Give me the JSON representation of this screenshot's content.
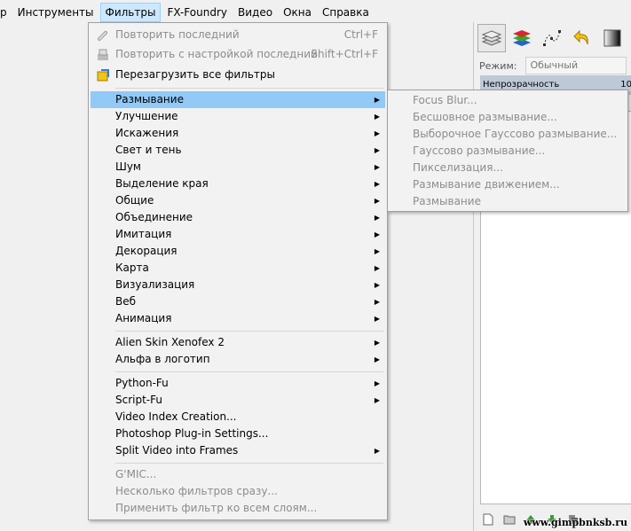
{
  "menubar": {
    "items": [
      {
        "label": "р"
      },
      {
        "label": "Инструменты"
      },
      {
        "label": "Фильтры"
      },
      {
        "label": "FX-Foundry"
      },
      {
        "label": "Видео"
      },
      {
        "label": "Окна"
      },
      {
        "label": "Справка"
      }
    ]
  },
  "filters_menu": {
    "repeat_last": {
      "label": "Повторить последний",
      "shortcut": "Ctrl+F"
    },
    "reshow_last": {
      "label": "Повторить с настройкой последний",
      "shortcut": "Shift+Ctrl+F"
    },
    "reset_all": {
      "label": "Перезагрузить все фильтры"
    },
    "categories": [
      {
        "label": "Размывание"
      },
      {
        "label": "Улучшение"
      },
      {
        "label": "Искажения"
      },
      {
        "label": "Свет и тень"
      },
      {
        "label": "Шум"
      },
      {
        "label": "Выделение края"
      },
      {
        "label": "Общие"
      },
      {
        "label": "Объединение"
      },
      {
        "label": "Имитация"
      },
      {
        "label": "Декорация"
      },
      {
        "label": "Карта"
      },
      {
        "label": "Визуализация"
      },
      {
        "label": "Веб"
      },
      {
        "label": "Анимация"
      }
    ],
    "plugins": [
      {
        "label": "Alien Skin Xenofex 2"
      },
      {
        "label": "Альфа в логотип"
      }
    ],
    "scripts": [
      {
        "label": "Python-Fu"
      },
      {
        "label": "Script-Fu"
      },
      {
        "label": "Video Index Creation..."
      },
      {
        "label": "Photoshop Plug-in Settings..."
      },
      {
        "label": "Split Video into Frames"
      }
    ],
    "disabled_tail": [
      {
        "label": "G'MIC..."
      },
      {
        "label": "Несколько фильтров сразу..."
      },
      {
        "label": "Применить фильтр ко всем слоям..."
      }
    ]
  },
  "blur_submenu": {
    "items": [
      {
        "label": "Focus Blur..."
      },
      {
        "label": "Бесшовное размывание..."
      },
      {
        "label": "Выборочное Гауссово размывание..."
      },
      {
        "label": "Гауссово размывание..."
      },
      {
        "label": "Пикселизация..."
      },
      {
        "label": "Размывание движением..."
      },
      {
        "label": "Размывание"
      }
    ]
  },
  "dock": {
    "mode_label": "Режим:",
    "mode_value": "Обычный",
    "opacity_label": "Непрозрачность",
    "opacity_value": "10"
  },
  "watermark": "www.gimpbnksb.ru",
  "colors": {
    "highlight": "#91c9f7",
    "menubar_active": "#cce8ff",
    "disabled_text": "#8c8c8c"
  }
}
